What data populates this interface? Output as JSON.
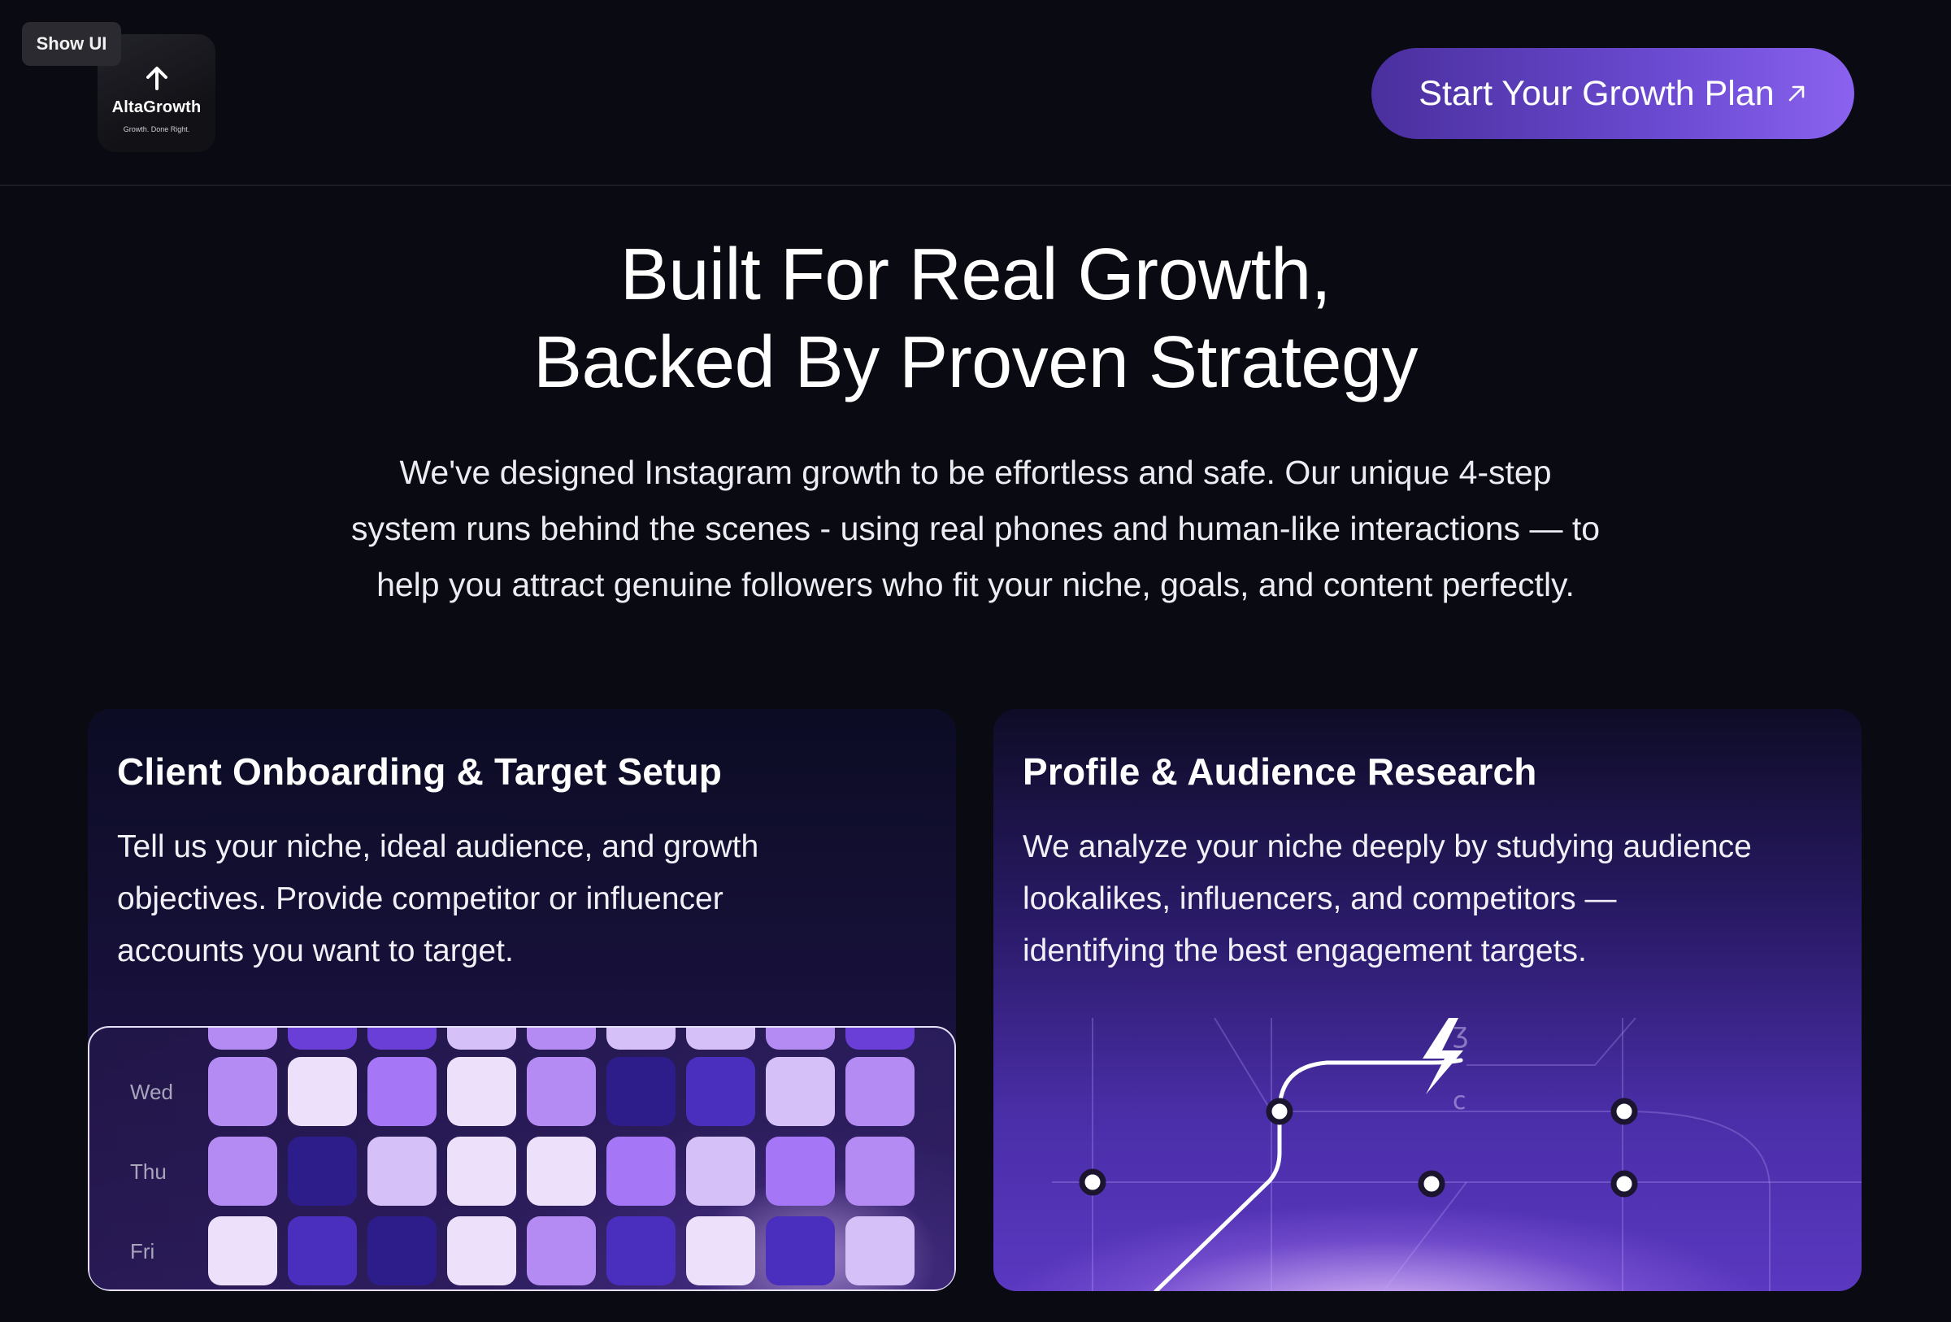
{
  "header": {
    "show_ui_label": "Show UI",
    "logo": {
      "name": "AltaGrowth",
      "tagline": "Growth. Done Right.",
      "icon": "up-arrow-icon"
    },
    "cta": {
      "label": "Start Your Growth Plan",
      "icon": "arrow-up-right-icon"
    }
  },
  "hero": {
    "title_line1": "Built For Real Growth,",
    "title_line2": "Backed By Proven Strategy",
    "text_line1": "We've designed Instagram growth to be effortless and safe. Our unique 4-step",
    "text_line2": "system runs behind the scenes - using real phones and human-like interactions — to",
    "text_line3": "help you attract genuine followers who fit your niche, goals, and content perfectly."
  },
  "cards": [
    {
      "title": "Client Onboarding & Target Setup",
      "text_line1": "Tell us your niche, ideal audience, and growth",
      "text_line2": "objectives. Provide competitor or influencer",
      "text_line3": "accounts you want to target."
    },
    {
      "title": "Profile & Audience Research",
      "text_line1": "We analyze your niche deeply by studying audience",
      "text_line2": "lookalikes, influencers, and competitors —",
      "text_line3": "identifying the best engagement targets."
    }
  ],
  "heatmap": {
    "rows": [
      {
        "label": "",
        "levels": [
          2,
          0,
          0,
          3,
          2,
          3,
          3,
          2,
          0
        ]
      },
      {
        "label": "Wed",
        "levels": [
          2,
          4,
          1,
          4,
          2,
          5,
          6,
          3,
          2
        ]
      },
      {
        "label": "Thu",
        "levels": [
          2,
          5,
          3,
          4,
          4,
          1,
          3,
          1,
          2
        ]
      },
      {
        "label": "Fri",
        "levels": [
          4,
          6,
          5,
          4,
          2,
          6,
          4,
          6,
          3
        ]
      }
    ],
    "palette": [
      "#6a3fd8",
      "#a577f6",
      "#b48af3",
      "#d5c0f7",
      "#ece0fb",
      "#2d1d8a",
      "#4a2ebd"
    ]
  },
  "network": {
    "node_icon": "node-dot-icon",
    "bolt_icon": "lightning-bolt-icon"
  },
  "colors": {
    "background": "#0a0a12",
    "cta_start": "#4a2f9e",
    "cta_end": "#8a62ef",
    "accent": "#7c5ce0"
  }
}
